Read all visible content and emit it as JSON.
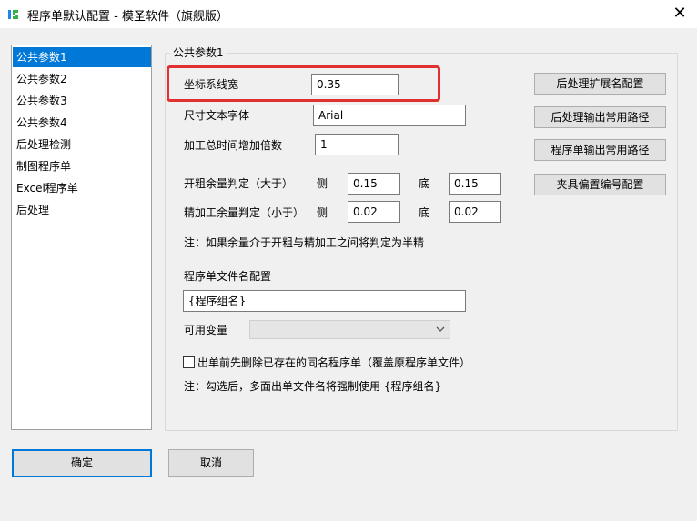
{
  "window": {
    "title": "程序单默认配置 - 模圣软件（旗舰版）",
    "close_glyph": "✕"
  },
  "sidebar": {
    "items": [
      {
        "label": "公共参数1",
        "selected": true
      },
      {
        "label": "公共参数2",
        "selected": false
      },
      {
        "label": "公共参数3",
        "selected": false
      },
      {
        "label": "公共参数4",
        "selected": false
      },
      {
        "label": "后处理检测",
        "selected": false
      },
      {
        "label": "制图程序单",
        "selected": false
      },
      {
        "label": "Excel程序单",
        "selected": false
      },
      {
        "label": "后处理",
        "selected": false
      }
    ]
  },
  "panel": {
    "group_title": "公共参数1",
    "coord_width": {
      "label": "坐标系线宽",
      "value": "0.35"
    },
    "dim_font": {
      "label": "尺寸文本字体",
      "value": "Arial"
    },
    "time_multiplier": {
      "label": "加工总时间增加倍数",
      "value": "1"
    },
    "rough_allowance": {
      "label": "开粗余量判定（大于）",
      "side_label": "侧",
      "side_value": "0.15",
      "bottom_label": "底",
      "bottom_value": "0.15"
    },
    "finish_allowance": {
      "label": "精加工余量判定（小于）",
      "side_label": "侧",
      "side_value": "0.02",
      "bottom_label": "底",
      "bottom_value": "0.02"
    },
    "note1": "注：如果余量介于开粗与精加工之间将判定为半精",
    "filename_label": "程序单文件名配置",
    "filename_value": "{程序组名}",
    "variables_label": "可用变量",
    "variables_value": "",
    "delete_checkbox": {
      "label": "出单前先删除已存在的同名程序单（覆盖原程序单文件）",
      "checked": false
    },
    "note2": "注：勾选后，多面出单文件名将强制使用 {程序组名}"
  },
  "side_buttons": {
    "post_ext": "后处理扩展名配置",
    "post_path": "后处理输出常用路径",
    "prog_path": "程序单输出常用路径",
    "fixture": "夹具偏置编号配置"
  },
  "footer": {
    "ok": "确定",
    "cancel": "取消"
  },
  "colors": {
    "selection": "#0078d7",
    "highlight_border": "#e0302f",
    "app_icon_blue": "#1e88e5",
    "app_icon_green": "#2db34a"
  }
}
